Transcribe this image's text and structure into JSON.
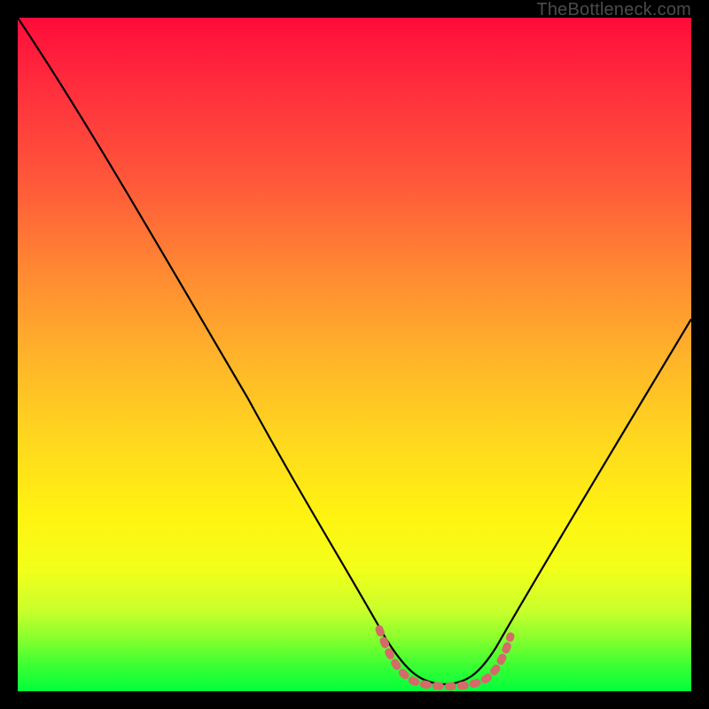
{
  "watermark": "TheBottleneck.com",
  "chart_data": {
    "type": "line",
    "title": "",
    "xlabel": "",
    "ylabel": "",
    "xlim": [
      0,
      100
    ],
    "ylim": [
      0,
      100
    ],
    "grid": false,
    "legend": false,
    "annotations": [],
    "series": [
      {
        "name": "bottleneck-curve",
        "color": "#000000",
        "x": [
          0,
          5,
          10,
          15,
          20,
          25,
          30,
          35,
          40,
          45,
          50,
          53,
          56,
          59,
          62,
          65,
          68,
          71,
          74,
          78,
          82,
          86,
          90,
          94,
          98,
          100
        ],
        "y": [
          100,
          93,
          86,
          78,
          70,
          62,
          54,
          46,
          38,
          30,
          22,
          14,
          7,
          3,
          1,
          1,
          1,
          2,
          3,
          8,
          16,
          25,
          35,
          45,
          55,
          60
        ]
      },
      {
        "name": "optimal-region-marker",
        "color": "#d46a6a",
        "x": [
          53,
          55,
          57,
          59,
          61,
          63,
          65,
          67,
          69,
          71,
          72,
          73
        ],
        "y": [
          9,
          6,
          4,
          3,
          2,
          2,
          2,
          2,
          3,
          4,
          6,
          9
        ]
      }
    ],
    "background_gradient": {
      "top": "#ff0b3a",
      "mid": "#ffe016",
      "bottom": "#00ff3c"
    }
  }
}
